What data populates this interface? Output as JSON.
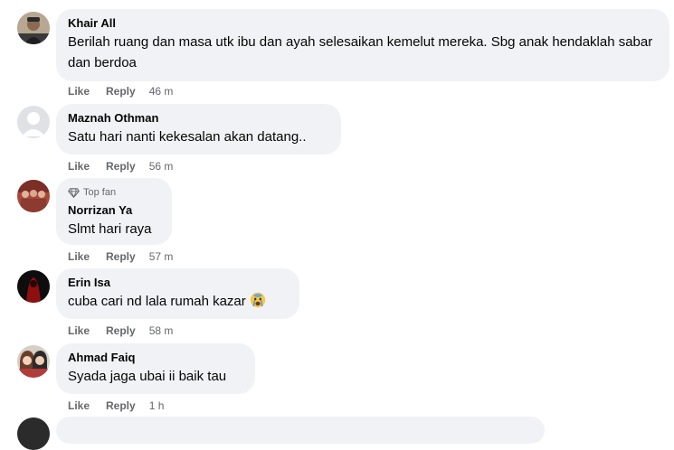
{
  "actions": {
    "like": "Like",
    "reply": "Reply"
  },
  "comments": [
    {
      "author": "Khair All",
      "text": "Berilah ruang dan masa utk ibu dan ayah selesaikan kemelut mereka. Sbg anak hendaklah sabar dan berdoa",
      "time": "46 m",
      "avatar": "man-portrait"
    },
    {
      "author": "Maznah Othman",
      "text": "Satu hari nanti kekesalan akan datang..",
      "time": "56 m",
      "avatar": "default-avatar"
    },
    {
      "badge": "Top fan",
      "author": "Norrizan Ya",
      "text": "Slmt hari raya",
      "time": "57 m",
      "avatar": "group-photo"
    },
    {
      "author": "Erin Isa",
      "text": "cuba cari nd lala rumah kazar",
      "time": "58 m",
      "avatar": "dark-red-portrait",
      "emoji": "crying-face"
    },
    {
      "author": "Ahmad Faiq",
      "text": "Syada jaga ubai ii baik tau",
      "time": "1 h",
      "avatar": "anime-couple"
    }
  ],
  "colors": {
    "bubble": "#f0f2f5",
    "meta": "#65676b",
    "text": "#050505"
  }
}
